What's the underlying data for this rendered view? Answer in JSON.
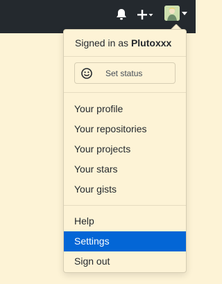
{
  "header": {
    "icons": [
      "bell-icon",
      "plus-icon",
      "avatar",
      "caret-down-icon"
    ]
  },
  "menu": {
    "signed_in_prefix": "Signed in as",
    "username": "Plutoxxx",
    "status_button": {
      "label": "Set status",
      "icon": "smiley-icon"
    },
    "section1": [
      "Your profile",
      "Your repositories",
      "Your projects",
      "Your stars",
      "Your gists"
    ],
    "section2": [
      "Help",
      "Settings",
      "Sign out"
    ],
    "active_item": "Settings"
  },
  "colors": {
    "topbar": "#24292e",
    "page_bg": "#fdf3d6",
    "active_bg": "#0366d6"
  }
}
